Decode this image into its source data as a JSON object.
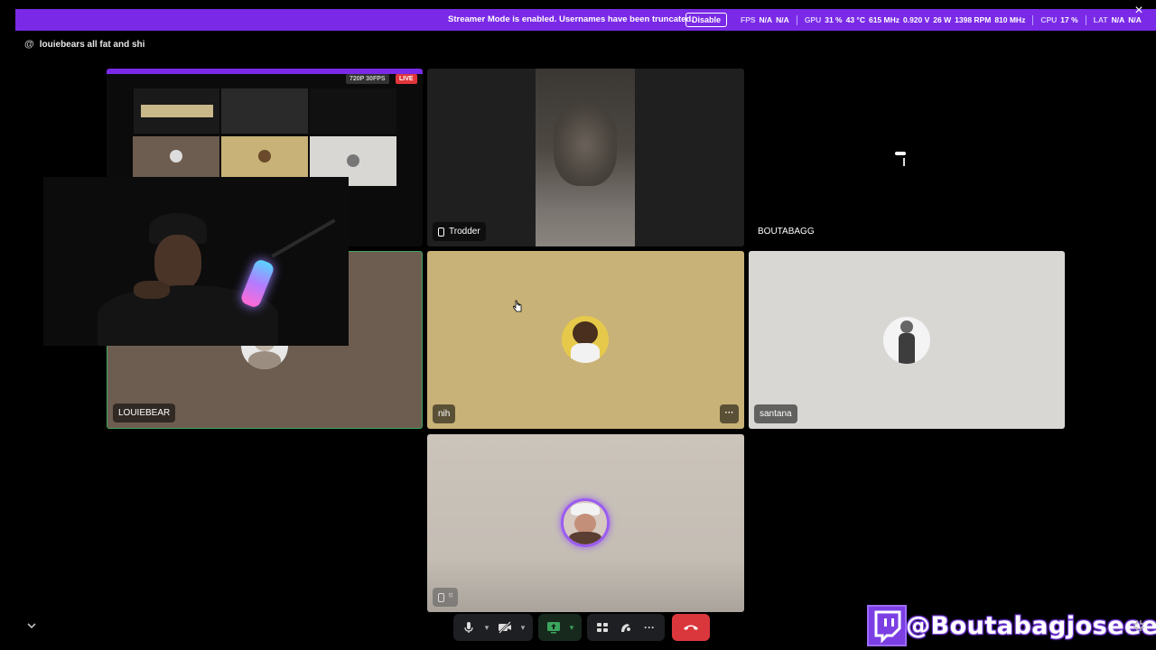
{
  "banner": {
    "message": "Streamer Mode is enabled. Usernames have been truncated.",
    "disable_label": "Disable",
    "stats": {
      "fps_label": "FPS",
      "fps_1": "N/A",
      "fps_2": "N/A",
      "gpu_label": "GPU",
      "gpu_load": "31 %",
      "gpu_temp": "43 °C",
      "gpu_clock": "615 MHz",
      "gpu_volt": "0.920 V",
      "gpu_power": "26 W",
      "gpu_fan": "1398 RPM",
      "gpu_mem": "810 MHz",
      "cpu_label": "CPU",
      "cpu_load": "17 %",
      "lat_label": "LAT",
      "lat_1": "N/A",
      "lat_2": "N/A"
    },
    "close_icon": "×"
  },
  "channel": {
    "at": "@",
    "name": "louiebears all fat and shi"
  },
  "stream_preview": {
    "quality": "720P 30FPS",
    "live": "LIVE"
  },
  "participants": [
    {
      "name": "Trodder",
      "device": "mobile"
    },
    {
      "name": "BOUTABAGG"
    },
    {
      "name": "LOUIEBEAR"
    },
    {
      "name": "nih"
    },
    {
      "name": "santana"
    },
    {
      "name": "ᵗᵗ",
      "device": "mobile"
    }
  ],
  "tile_more_icon": "···",
  "controls": {
    "mic_icon": "mic-icon",
    "camera_icon": "camera-off-icon",
    "screen_share_icon": "screen-share-icon",
    "activities_icon": "activities-icon",
    "soundboard_icon": "soundboard-icon",
    "more_icon": "···",
    "hangup_icon": "hangup-icon"
  },
  "colors": {
    "banner": "#7a2ae6",
    "speaking_border": "#3ba55d",
    "hangup": "#da373c",
    "tile_louiebear": "#6d5d50",
    "tile_nih": "#c8b277",
    "tile_santana": "#d8d7d4",
    "tile_bottom": "#c7bfb6"
  },
  "twitch": {
    "handle": "@Boutabagjoseee"
  }
}
